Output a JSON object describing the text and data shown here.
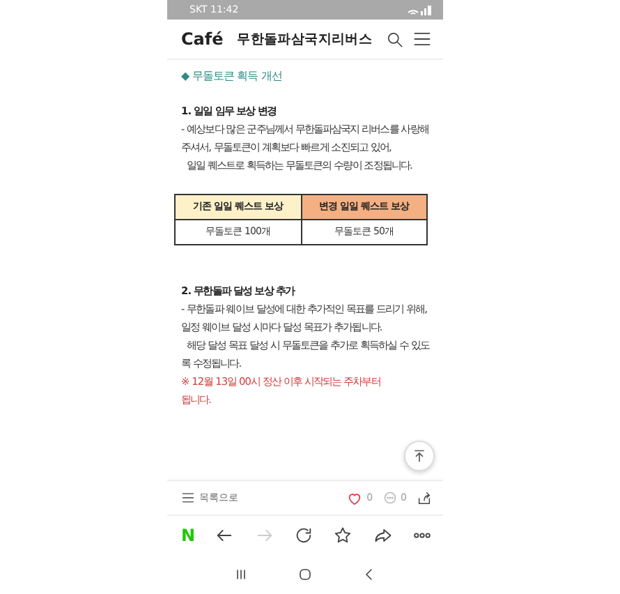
{
  "status_bar": {
    "carrier_time": "SKT 11:42"
  },
  "header": {
    "logo": "Café",
    "title": "무한돌파삼국지리버스"
  },
  "article": {
    "section_title": "◆ 무돌토큰 획득 개선",
    "blocks": [
      {
        "kind": "heading",
        "text": "1. 일일 임무 보상 변경"
      },
      {
        "kind": "para",
        "text": "- 예상보다 많은 군주님께서 무한돌파삼국지 리버스를 사랑해주셔서, 무돌토큰이 계획보다 빠르게 소진되고 있어,"
      },
      {
        "kind": "para",
        "text": "  일일 퀘스트로 획득하는 무돌토큰의 수량이 조정됩니다."
      },
      {
        "kind": "table",
        "columns": [
          {
            "label": "기존 일일 퀘스트 보상",
            "color": "#fdf1c9"
          },
          {
            "label": "변경 일일 퀘스트 보상",
            "color": "#f4b083"
          }
        ],
        "rows": [
          [
            "무돌토큰 100개",
            "무돌토큰 50개"
          ]
        ]
      },
      {
        "kind": "heading",
        "text": "2. 무한돌파 달성 보상 추가"
      },
      {
        "kind": "para",
        "text": "- 무한돌파 웨이브 달성에 대한 추가적인 목표를 드리기 위해, 일정 웨이브 달성 시마다 달성 목표가 추가됩니다."
      },
      {
        "kind": "para",
        "text": "  해당 달성 목표 달성 시 무돌토큰을 추가로 획득하실 수 있도록 수정됩니다."
      },
      {
        "kind": "note",
        "text": "※ 12월 13일 00시 정산 이후 시작되는 주차부터"
      },
      {
        "kind": "note",
        "text": "됩니다."
      }
    ]
  },
  "action_bar": {
    "list_label": "목록으로",
    "likes": "0",
    "comments": "0"
  },
  "browser_bar": {
    "logo": "N",
    "forward_disabled": true
  }
}
